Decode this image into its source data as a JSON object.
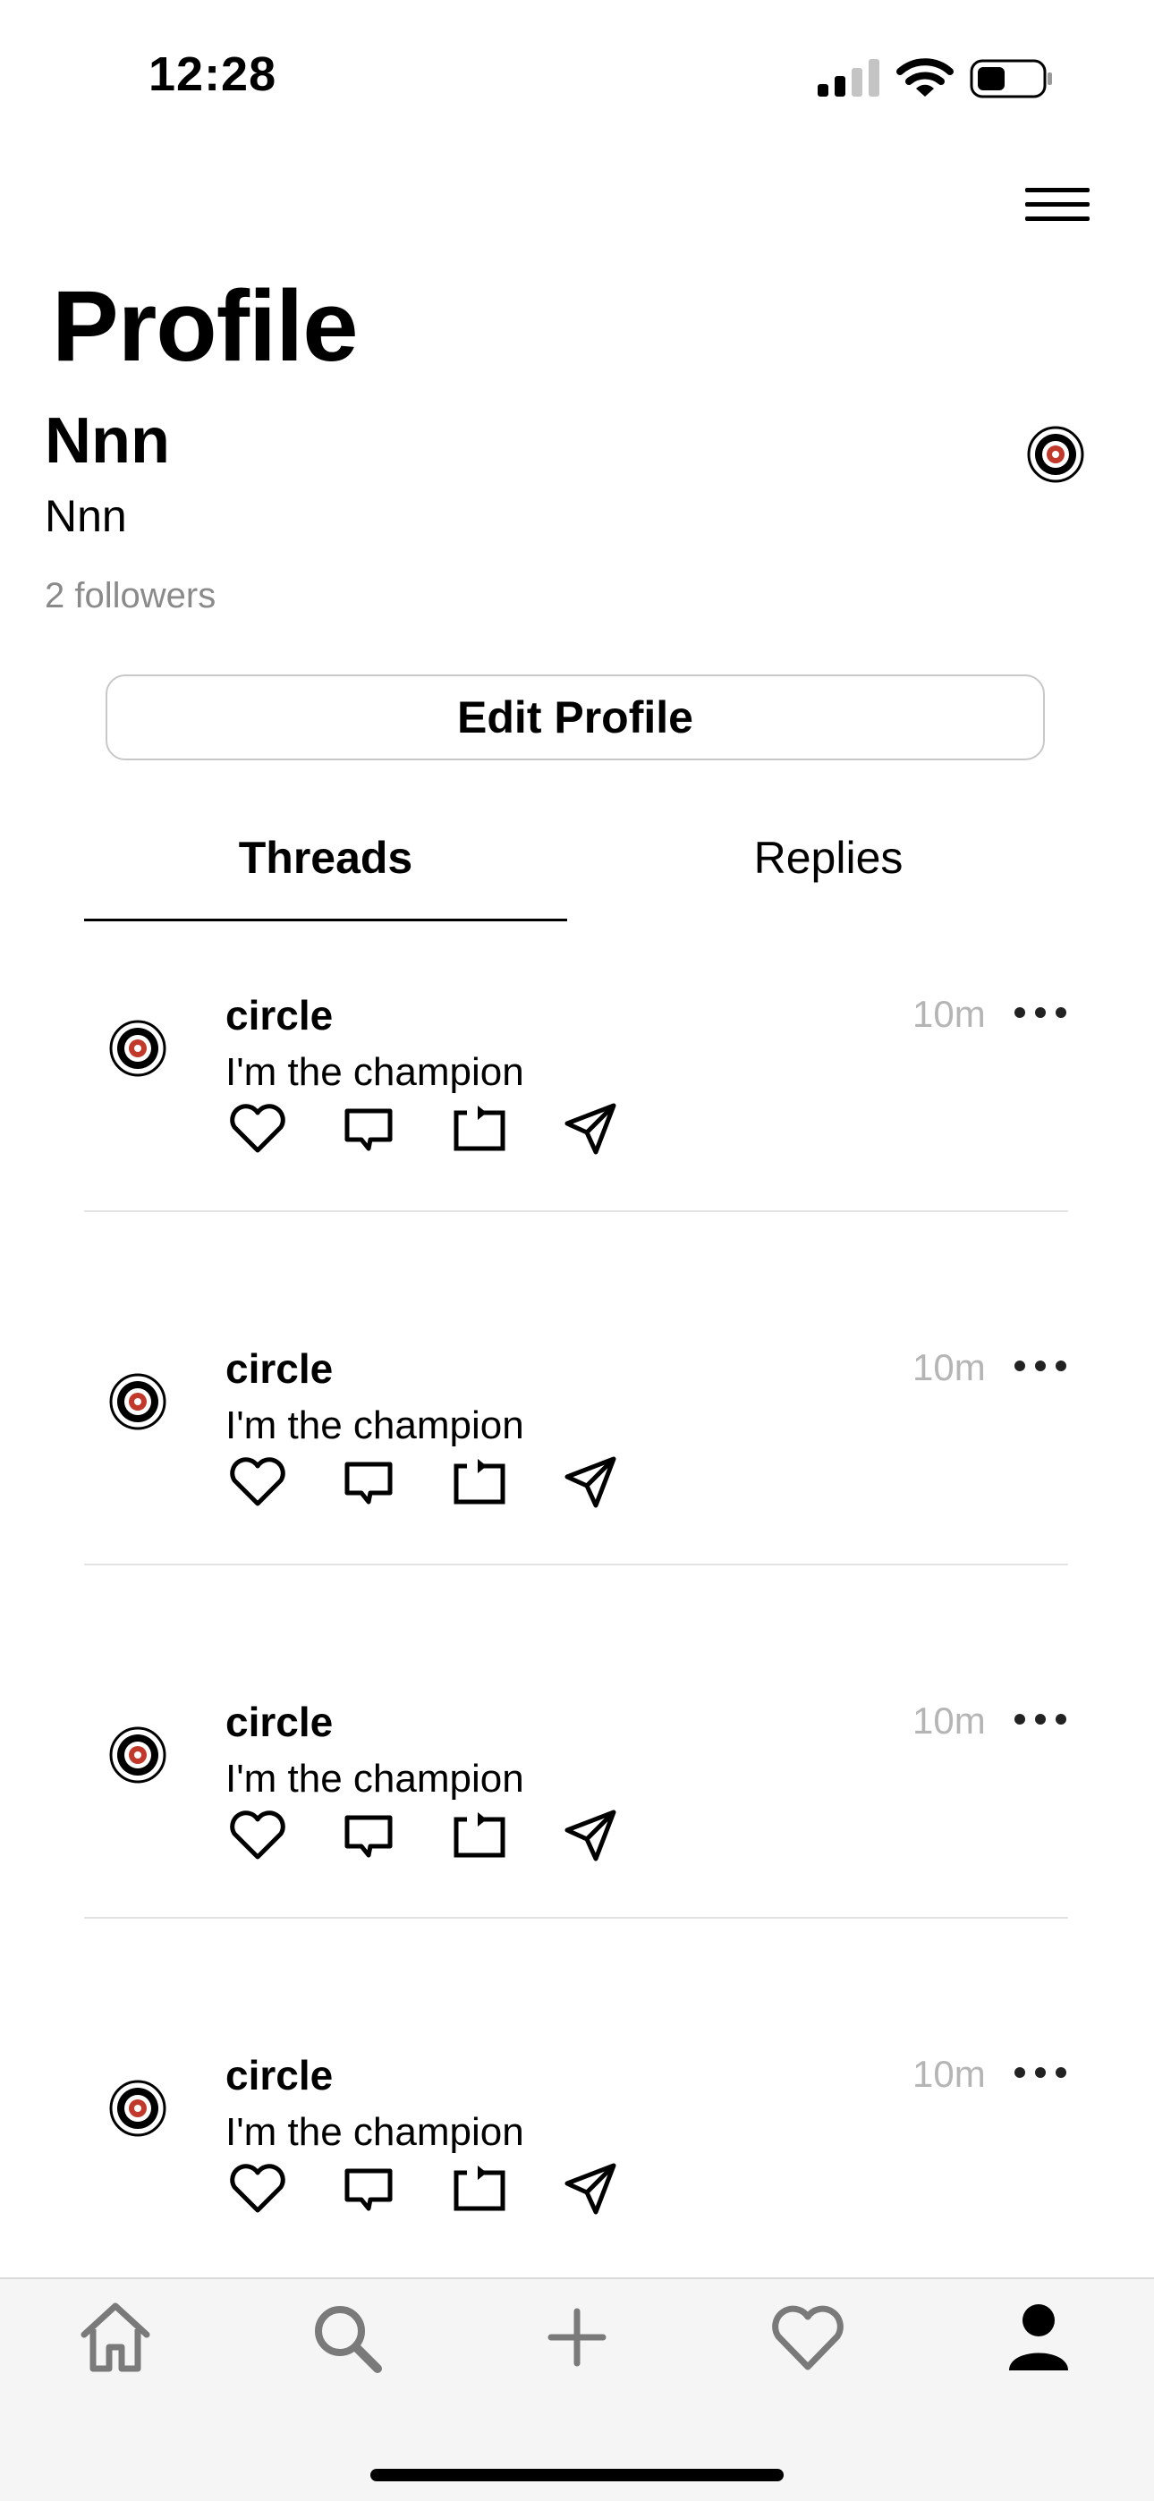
{
  "status_bar": {
    "time": "12:28"
  },
  "profile": {
    "title": "Profile",
    "display_name": "Nnn",
    "username": "Nnn",
    "followers": "2 followers",
    "edit_label": "Edit Profile"
  },
  "tabs": [
    {
      "label": "Threads",
      "selected": true
    },
    {
      "label": "Replies",
      "selected": false
    }
  ],
  "posts": [
    {
      "author": "circle",
      "time": "10m",
      "content": "I'm the champion"
    },
    {
      "author": "circle",
      "time": "10m",
      "content": "I'm the champion"
    },
    {
      "author": "circle",
      "time": "10m",
      "content": "I'm the champion"
    },
    {
      "author": "circle",
      "time": "10m",
      "content": "I'm the champion"
    }
  ],
  "post_actions": [
    "heart-icon",
    "comment-icon",
    "repost-icon",
    "send-icon"
  ],
  "tab_bar": [
    "home-icon",
    "search-icon",
    "plus-icon",
    "heart-icon",
    "profile-icon"
  ],
  "colors": {
    "secondary_text": "#8a8a8a",
    "timestamp": "#b5b5b5",
    "avatar_accent": "#c0392b"
  }
}
